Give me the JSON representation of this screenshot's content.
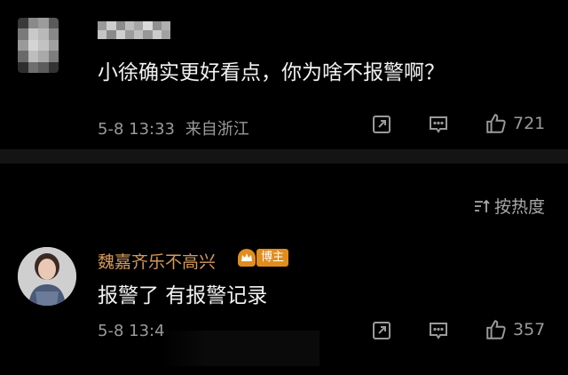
{
  "comments": [
    {
      "text": "小徐确实更好看点，你为啥不报警啊？",
      "time": "5-8 13:33",
      "location": "来自浙江",
      "likes": "721",
      "share_icon": "share-icon",
      "reply_icon": "comment-icon",
      "like_icon": "thumbs-up-icon"
    },
    {
      "user_name": "魏嘉齐乐不高兴",
      "badge_label": "博主",
      "text": "报警了 有报警记录",
      "time": "5-8 13:4",
      "likes": "357",
      "share_icon": "share-icon",
      "reply_icon": "comment-icon",
      "like_icon": "thumbs-up-icon"
    }
  ],
  "sort": {
    "label": "按热度",
    "icon": "sort-icon"
  },
  "colors": {
    "background": "#000000",
    "username": "#d69a5a",
    "badge": "#e08d1e",
    "meta": "#9a9a9a"
  }
}
